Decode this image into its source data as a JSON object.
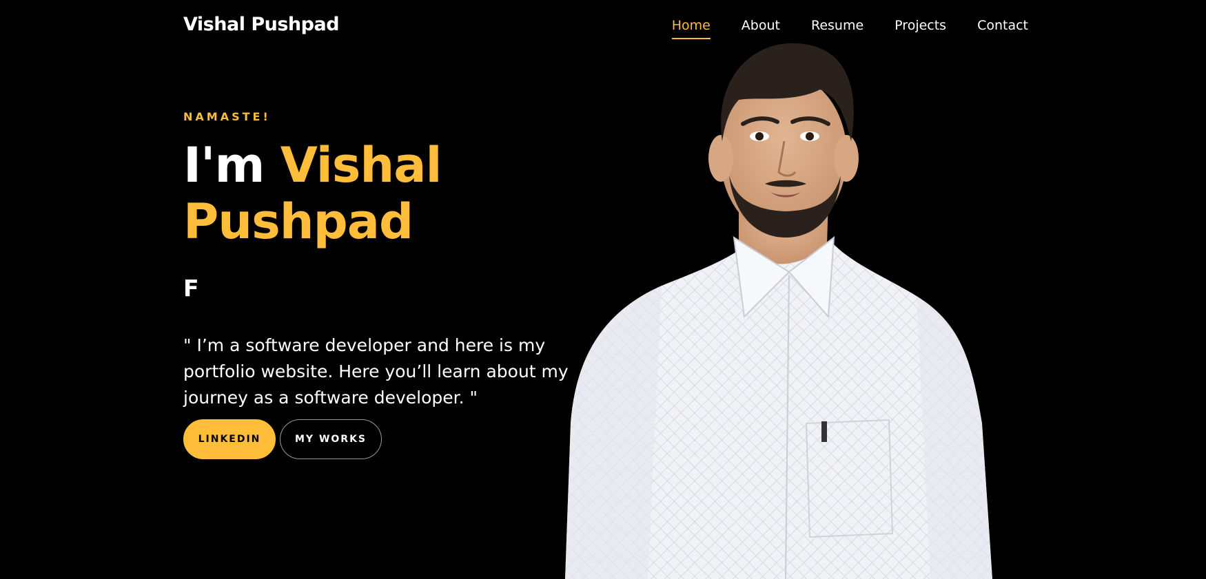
{
  "header": {
    "brand": "Vishal Pushpad",
    "nav": [
      {
        "label": "Home",
        "active": true
      },
      {
        "label": "About",
        "active": false
      },
      {
        "label": "Resume",
        "active": false
      },
      {
        "label": "Projects",
        "active": false
      },
      {
        "label": "Contact",
        "active": false
      }
    ]
  },
  "hero": {
    "greeting": "NAMASTE!",
    "title_prefix": "I'm",
    "title_name_line1": "Vishal",
    "title_name_line2": "Pushpad",
    "typing_text": "F",
    "quote": "\" I’m a software developer and here is my portfolio website. Here you’ll learn about my journey as a software developer. \"",
    "buttons": {
      "linkedin": "LINKEDIN",
      "my_works": "MY WORKS"
    }
  },
  "colors": {
    "background": "#000000",
    "accent": "#ffbd39",
    "text": "#ffffff"
  },
  "images": {
    "portrait": "person-portrait"
  }
}
